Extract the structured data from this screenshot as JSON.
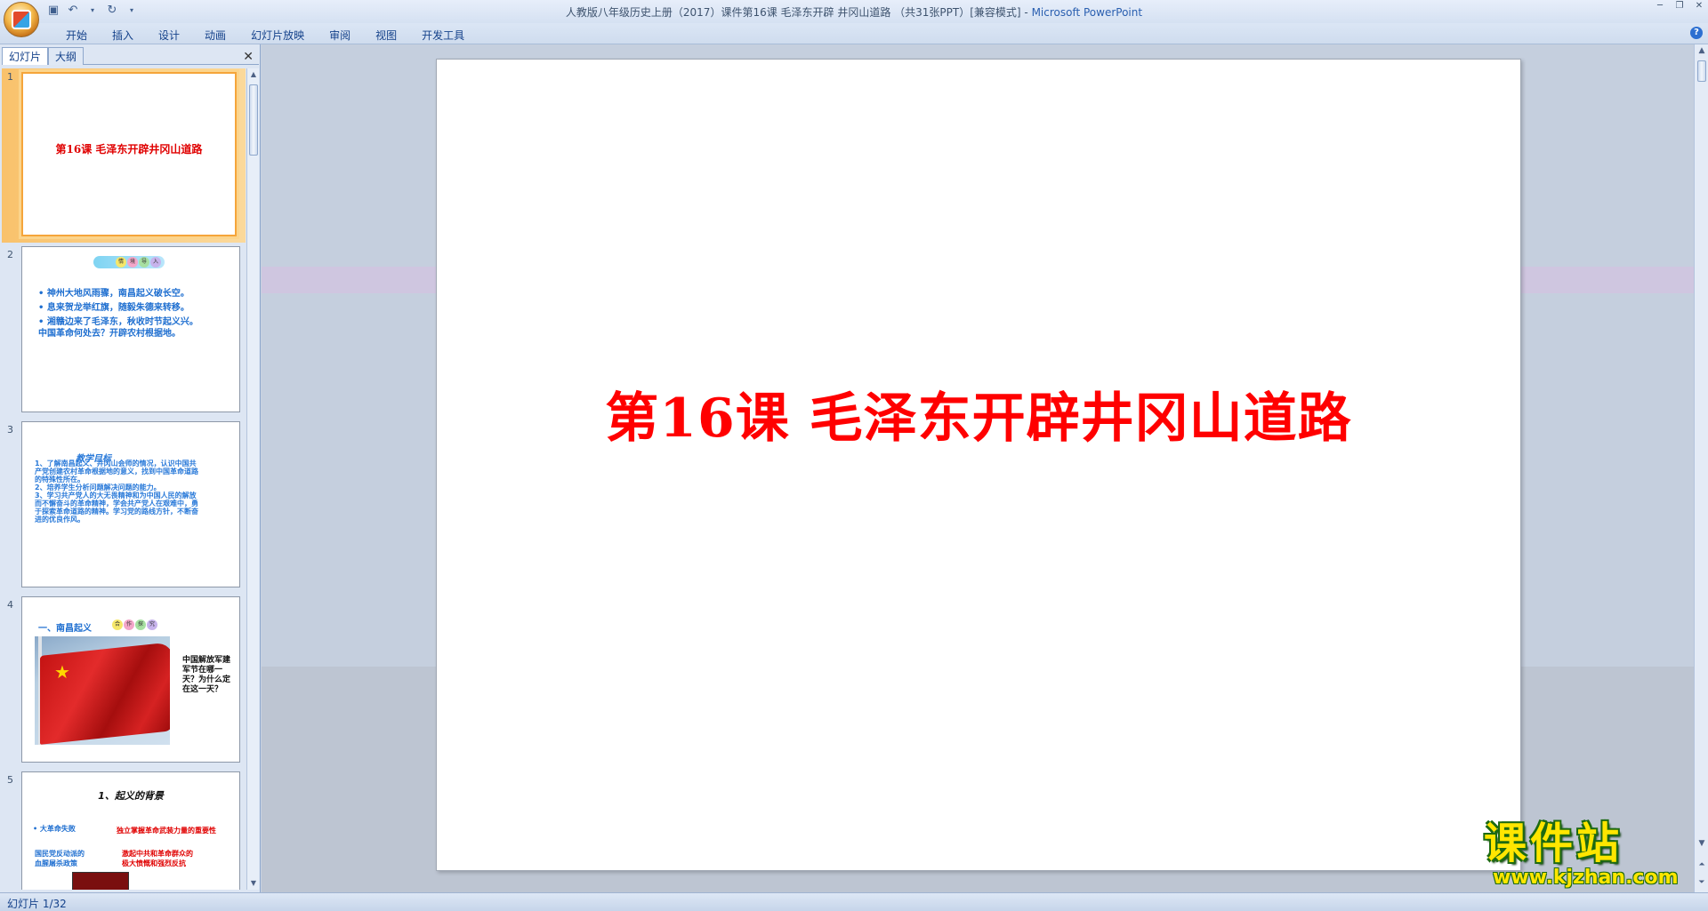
{
  "window": {
    "title": "人教版八年级历史上册（2017）课件第16课 毛泽东开辟 井冈山道路 （共31张PPT）[兼容模式]",
    "title_sep": " - ",
    "app_name": "Microsoft PowerPoint"
  },
  "ribbon": {
    "tabs": [
      "开始",
      "插入",
      "设计",
      "动画",
      "幻灯片放映",
      "审阅",
      "视图",
      "开发工具"
    ]
  },
  "left_panel": {
    "tabs": [
      "幻灯片",
      "大纲"
    ],
    "close_glyph": "✕"
  },
  "slides": [
    {
      "num": "1",
      "title": "第16课  毛泽东开辟井冈山道路"
    },
    {
      "num": "2",
      "banner": [
        "情",
        "境",
        "导",
        "入"
      ],
      "bullets": [
        "神州大地风雨骤，南昌起义破长空。",
        "息来贺龙举红旗，随毅朱德来转移。",
        "湘赣边来了毛泽东，秋收时节起义兴。\n中国革命何处去？开辟农村根据地。"
      ]
    },
    {
      "num": "3",
      "heading": "教学目标",
      "text": "1、了解南昌起义、井冈山会师的情况，认识中国共产党创建农村革命根据地的意义，找到中国革命道路的特殊性所在。\n2、培养学生分析问题解决问题的能力。\n3、学习共产党人的大无畏精神和为中国人民的解放而不懈奋斗的革命精神，学会共产党人在艰难中，勇于探索革命道路的精神。学习党的路线方针，不断奋进的优良作风。"
    },
    {
      "num": "4",
      "heading": "一、南昌起义",
      "banner": [
        "合",
        "作",
        "探",
        "究"
      ],
      "question": "中国解放军建军节在哪一天？为什么定在这一天？"
    },
    {
      "num": "5",
      "title": "1、起义的背景",
      "items": [
        {
          "text": "• 大革命失败",
          "color": "#1f6fd0"
        },
        {
          "text": "独立掌握革命武装力量的重要性",
          "color": "#e00000"
        },
        {
          "text": "国民党反动派的\n血腥屠杀政策",
          "color": "#1f6fd0"
        },
        {
          "text": "激起中共和革命群众的\n极大愤慨和强烈反抗",
          "color": "#e00000"
        }
      ]
    }
  ],
  "main_slide": {
    "title": "第16课  毛泽东开辟井冈山道路",
    "title_color": "#ff0000"
  },
  "status": {
    "slide_indicator": "幻灯片 1/32"
  },
  "watermark": {
    "brand": "课件站",
    "url": "www.kjzhan.com"
  }
}
